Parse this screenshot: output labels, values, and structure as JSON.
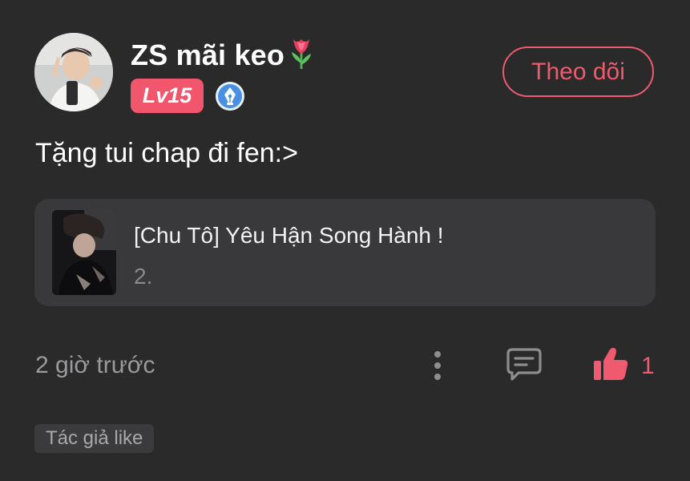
{
  "comment": {
    "username": "ZS mãi keo",
    "username_emoji": "tulip-icon",
    "level": "Lv15",
    "verified_icon": "pen-nib-badge-icon",
    "follow_label": "Theo dõi",
    "text": "Tặng tui chap đi fen:>",
    "chapter": {
      "title": "[Chu Tô] Yêu Hận Song Hành !",
      "subtitle": "2."
    },
    "timestamp": "2 giờ trước",
    "like_count": "1",
    "author_like_tag": "Tác giả like"
  },
  "colors": {
    "background": "#2a2a2b",
    "card": "#39393b",
    "accent": "#f05a6f",
    "muted": "#9a9a9c"
  }
}
